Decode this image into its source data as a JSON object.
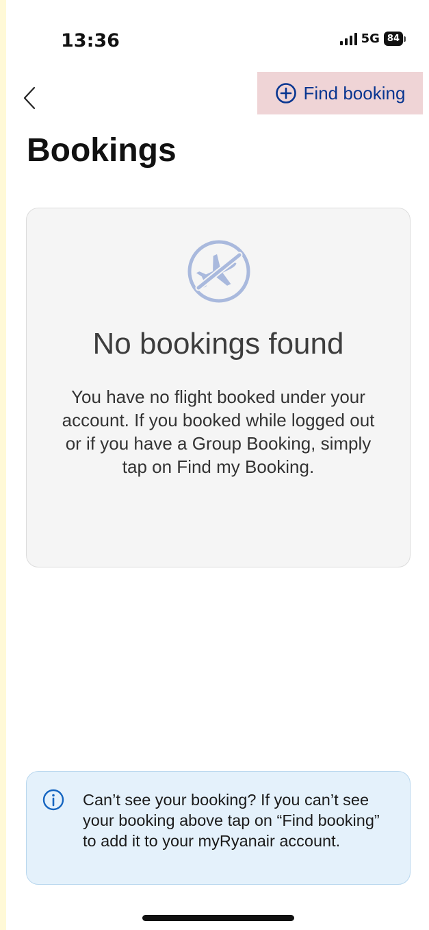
{
  "status_bar": {
    "time": "13:36",
    "network": "5G",
    "battery": "84",
    "icons": [
      "signal-icon",
      "battery-icon"
    ]
  },
  "header": {
    "back_icon": "chevron-left-icon",
    "find_booking_label": "Find booking",
    "find_booking_icon": "plus-circle-icon",
    "title": "Bookings"
  },
  "empty_state": {
    "icon": "no-flight-icon",
    "title": "No bookings found",
    "description": "You have no flight booked under your account. If you booked while logged out or if you have a Group Booking, simply tap on Find my Booking."
  },
  "info_banner": {
    "icon": "info-icon",
    "text": "Can’t see your booking? If you can’t see your booking above tap on “Find booking” to add it to your myRyanair account."
  },
  "colors": {
    "brand_blue": "#073590",
    "muted_icon": "#a9b9dd",
    "info_bg": "#e4f1fb",
    "highlight": "#efd4d6"
  }
}
